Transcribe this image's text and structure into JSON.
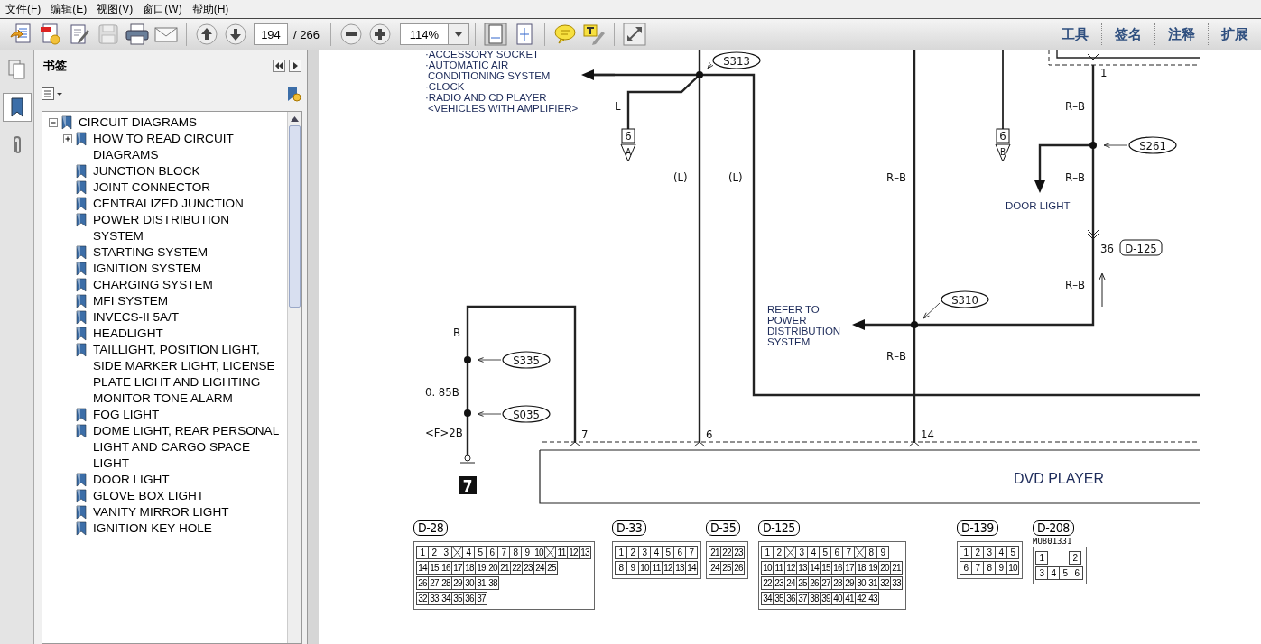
{
  "menu": [
    "文件(F)",
    "编辑(E)",
    "视图(V)",
    "窗口(W)",
    "帮助(H)"
  ],
  "toolbar": {
    "page_field": {
      "value": "194"
    },
    "page_count": "/ 266",
    "zoom_field": {
      "value": "114%"
    },
    "panel_tabs": [
      "工具",
      "签名",
      "注释",
      "扩展"
    ]
  },
  "side_panel": {
    "title": "书签",
    "bookmarks": [
      {
        "label": "CIRCUIT DIAGRAMS",
        "expanded": true,
        "children": [
          {
            "label": "HOW TO READ CIRCUIT DIAGRAMS",
            "expanded": false
          },
          {
            "label": "JUNCTION BLOCK"
          },
          {
            "label": "JOINT CONNECTOR"
          },
          {
            "label": "CENTRALIZED JUNCTION"
          },
          {
            "label": "POWER DISTRIBUTION SYSTEM"
          },
          {
            "label": "STARTING SYSTEM"
          },
          {
            "label": "IGNITION SYSTEM"
          },
          {
            "label": "CHARGING SYSTEM"
          },
          {
            "label": "MFI SYSTEM"
          },
          {
            "label": "INVECS-II 5A/T"
          },
          {
            "label": "HEADLIGHT"
          },
          {
            "label": "TAILLIGHT, POSITION LIGHT, SIDE MARKER LIGHT, LICENSE PLATE LIGHT AND LIGHTING MONITOR TONE ALARM"
          },
          {
            "label": "FOG LIGHT"
          },
          {
            "label": "DOME LIGHT, REAR PERSONAL LIGHT AND CARGO SPACE LIGHT"
          },
          {
            "label": "DOOR LIGHT"
          },
          {
            "label": "GLOVE BOX LIGHT"
          },
          {
            "label": "VANITY MIRROR LIGHT"
          },
          {
            "label": "IGNITION KEY HOLE"
          }
        ]
      }
    ]
  },
  "diagram": {
    "feed_list": [
      "·ACCESSORY SOCKET",
      "·AUTOMATIC AIR",
      "CONDITIONING SYSTEM",
      "·CLOCK",
      "·RADIO AND CD PLAYER",
      "<VEHICLES WITH AMPLIFIER>"
    ],
    "splices": [
      "S313",
      "S261",
      "S310",
      "S335",
      "S035"
    ],
    "wire_labels": [
      "L",
      "(L)",
      "(L)",
      "R–B",
      "R–B",
      "R–B",
      "R–B",
      "R–B",
      "B",
      "0. 85B",
      "<F>2B"
    ],
    "terminals": [
      "7",
      "6",
      "14",
      "1",
      "36"
    ],
    "connector_refs": [
      {
        "pin": "6",
        "letter": "A"
      },
      {
        "pin": "6",
        "letter": "B"
      }
    ],
    "connector_tag": "D-125",
    "destinations": [
      {
        "lines": [
          "DOOR LIGHT"
        ]
      },
      {
        "lines": [
          "REFER TO",
          "POWER",
          "DISTRIBUTION",
          "SYSTEM"
        ]
      }
    ],
    "ground_mark": "7",
    "component": "DVD PLAYER"
  },
  "connectors": [
    {
      "label": "D-28",
      "rows": [
        [
          "1",
          "2",
          "3",
          {
            "kind": "blocked"
          },
          "4",
          "5",
          "6",
          "7",
          "8",
          "9",
          "10",
          {
            "kind": "blocked"
          },
          "11",
          "12",
          "13"
        ],
        [
          "14",
          "15",
          "16",
          "17",
          "18",
          "19",
          "20",
          "21",
          "22",
          "23",
          "24",
          "25"
        ],
        [
          "26",
          "27",
          "28",
          "29",
          "30",
          "31",
          "38"
        ],
        [
          "32",
          "33",
          "34",
          "35",
          "36",
          "37"
        ]
      ]
    },
    {
      "label": "D-33",
      "rows": [
        [
          "1",
          "2",
          "3",
          "4",
          "5",
          "6",
          "7"
        ],
        [
          "8",
          "9",
          "10",
          "11",
          "12",
          "13",
          "14"
        ]
      ]
    },
    {
      "label": "D-35",
      "rows": [
        [
          "21",
          "22",
          "23"
        ],
        [
          "24",
          "25",
          "26"
        ]
      ]
    },
    {
      "label": "D-125",
      "rows": [
        [
          "1",
          "2",
          {
            "kind": "blocked"
          },
          "3",
          "4",
          "5",
          "6",
          "7",
          {
            "kind": "blocked"
          },
          "8",
          "9"
        ],
        [
          "10",
          "11",
          "12",
          "13",
          "14",
          "15",
          "16",
          "17",
          "18",
          "19",
          "20",
          "21"
        ],
        [
          "22",
          "23",
          "24",
          "25",
          "26",
          "27",
          "28",
          "29",
          "30",
          "31",
          "32",
          "33"
        ],
        [
          "34",
          "35",
          "36",
          "37",
          "38",
          "39",
          "40",
          "41",
          "42",
          "43"
        ]
      ]
    },
    {
      "label": "D-139",
      "rows": [
        [
          "1",
          "2",
          "3",
          "4",
          "5"
        ],
        [
          "6",
          "7",
          "8",
          "9",
          "10"
        ]
      ]
    },
    {
      "label": "D-208",
      "part_no": "MU801331",
      "rows": [
        [
          "1",
          {
            "kind": "empty"
          },
          {
            "kind": "empty"
          },
          "2"
        ],
        [
          "3",
          "4",
          "5",
          "6"
        ]
      ]
    }
  ]
}
